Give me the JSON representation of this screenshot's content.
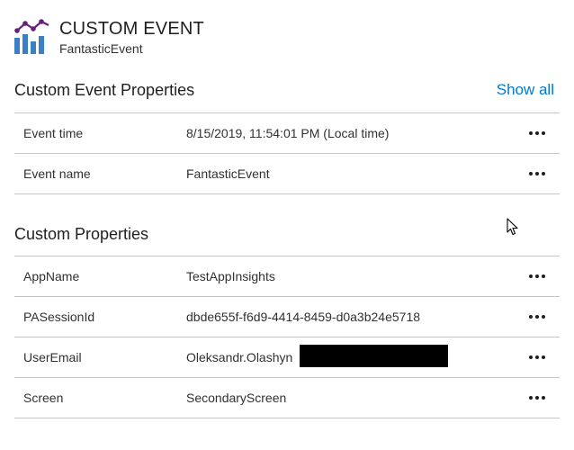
{
  "header": {
    "title": "CUSTOM EVENT",
    "subtitle": "FantasticEvent",
    "icon": "analytics-chart-icon",
    "icon_color": "#68217a"
  },
  "event_properties": {
    "heading": "Custom Event Properties",
    "show_all_label": "Show all",
    "rows": [
      {
        "name": "Event time",
        "value": "8/15/2019, 11:54:01 PM (Local time)"
      },
      {
        "name": "Event name",
        "value": "FantasticEvent"
      }
    ]
  },
  "custom_properties": {
    "heading": "Custom Properties",
    "rows": [
      {
        "name": "AppName",
        "value": "TestAppInsights"
      },
      {
        "name": "PASessionId",
        "value": "dbde655f-f6d9-4414-8459-d0a3b24e5718"
      },
      {
        "name": "UserEmail",
        "value": "Oleksandr.Olashyn"
      },
      {
        "name": "Screen",
        "value": "SecondaryScreen"
      }
    ]
  },
  "colors": {
    "link": "#0078d4",
    "divider": "#c8c6c4",
    "text": "#323130"
  }
}
